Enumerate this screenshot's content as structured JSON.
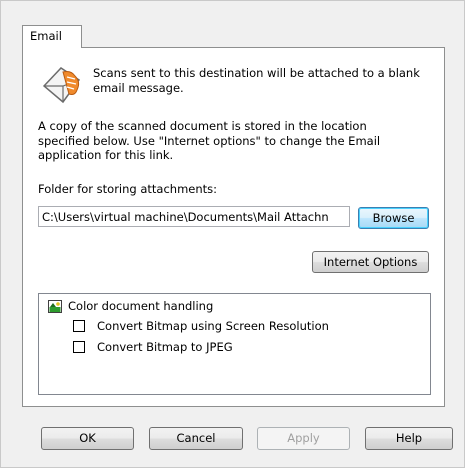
{
  "tab": {
    "label": "Email"
  },
  "description": "Scans sent to this destination will be attached to a blank email message.",
  "info_paragraph": "A copy of the scanned document is stored in the location specified below. Use \"Internet options\" to change the Email application for this link.",
  "folder": {
    "label": "Folder for storing attachments:",
    "value": "C:\\Users\\virtual machine\\Documents\\Mail Attachn",
    "browse_label": "Browse"
  },
  "internet_options_label": "Internet Options",
  "options_tree": {
    "group_label": "Color document handling",
    "items": [
      {
        "label": "Convert Bitmap using Screen Resolution",
        "checked": false
      },
      {
        "label": "Convert Bitmap to JPEG",
        "checked": false
      }
    ]
  },
  "buttons": {
    "ok": "OK",
    "cancel": "Cancel",
    "apply": "Apply",
    "help": "Help"
  }
}
